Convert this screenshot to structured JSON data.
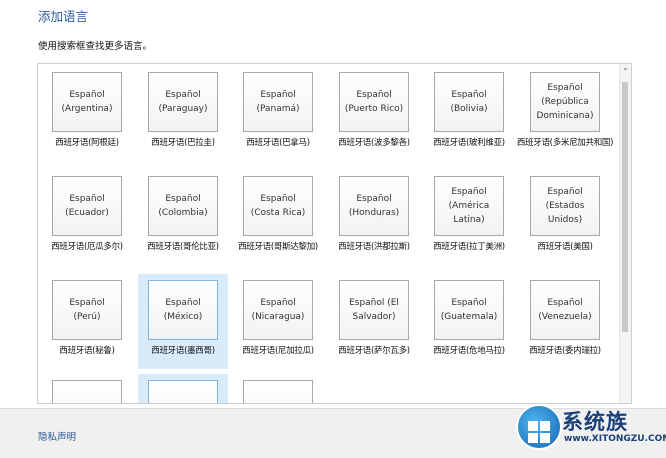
{
  "header": {
    "title": "添加语言",
    "subtitle": "使用搜索框查找更多语言。"
  },
  "languages": [
    {
      "name": "Español\n(Argentina)",
      "caption": "西班牙语(阿根廷)"
    },
    {
      "name": "Español\n(Paraguay)",
      "caption": "西班牙语(巴拉圭)"
    },
    {
      "name": "Español (Panamá)",
      "caption": "西班牙语(巴拿马)"
    },
    {
      "name": "Español (Puerto Rico)",
      "caption": "西班牙语(波多黎各)"
    },
    {
      "name": "Español (Bolivia)",
      "caption": "西班牙语(玻利维亚)"
    },
    {
      "name": "Español (República Dominicana)",
      "caption": "西班牙语(多米尼加共和国)"
    },
    {
      "name": "Español\n(Ecuador)",
      "caption": "西班牙语(厄瓜多尔)"
    },
    {
      "name": "Español\n(Colombia)",
      "caption": "西班牙语(哥伦比亚)"
    },
    {
      "name": "Español (Costa Rica)",
      "caption": "西班牙语(哥斯达黎加)"
    },
    {
      "name": "Español\n(Honduras)",
      "caption": "西班牙语(洪都拉斯)"
    },
    {
      "name": "Español (América Latina)",
      "caption": "西班牙语(拉丁美洲)"
    },
    {
      "name": "Español (Estados Unidos)",
      "caption": "西班牙语(美国)"
    },
    {
      "name": "Español (Perú)",
      "caption": "西班牙语(秘鲁)"
    },
    {
      "name": "Español (México)",
      "caption": "西班牙语(墨西哥)",
      "selected": true
    },
    {
      "name": "Español\n(Nicaragua)",
      "caption": "西班牙语(尼加拉瓜)"
    },
    {
      "name": "Español (El Salvador)",
      "caption": "西班牙语(萨尔瓦多)"
    },
    {
      "name": "Español\n(Guatemala)",
      "caption": "西班牙语(危地马拉)"
    },
    {
      "name": "Español\n(Venezuela)",
      "caption": "西班牙语(委内瑞拉)"
    }
  ],
  "footer": {
    "privacy_link": "隐私声明"
  },
  "watermark": {
    "text": "系统族",
    "sub": "www.XITONGZU.COM"
  },
  "scrollbar": {
    "up_icon": "chevron-up-icon"
  }
}
